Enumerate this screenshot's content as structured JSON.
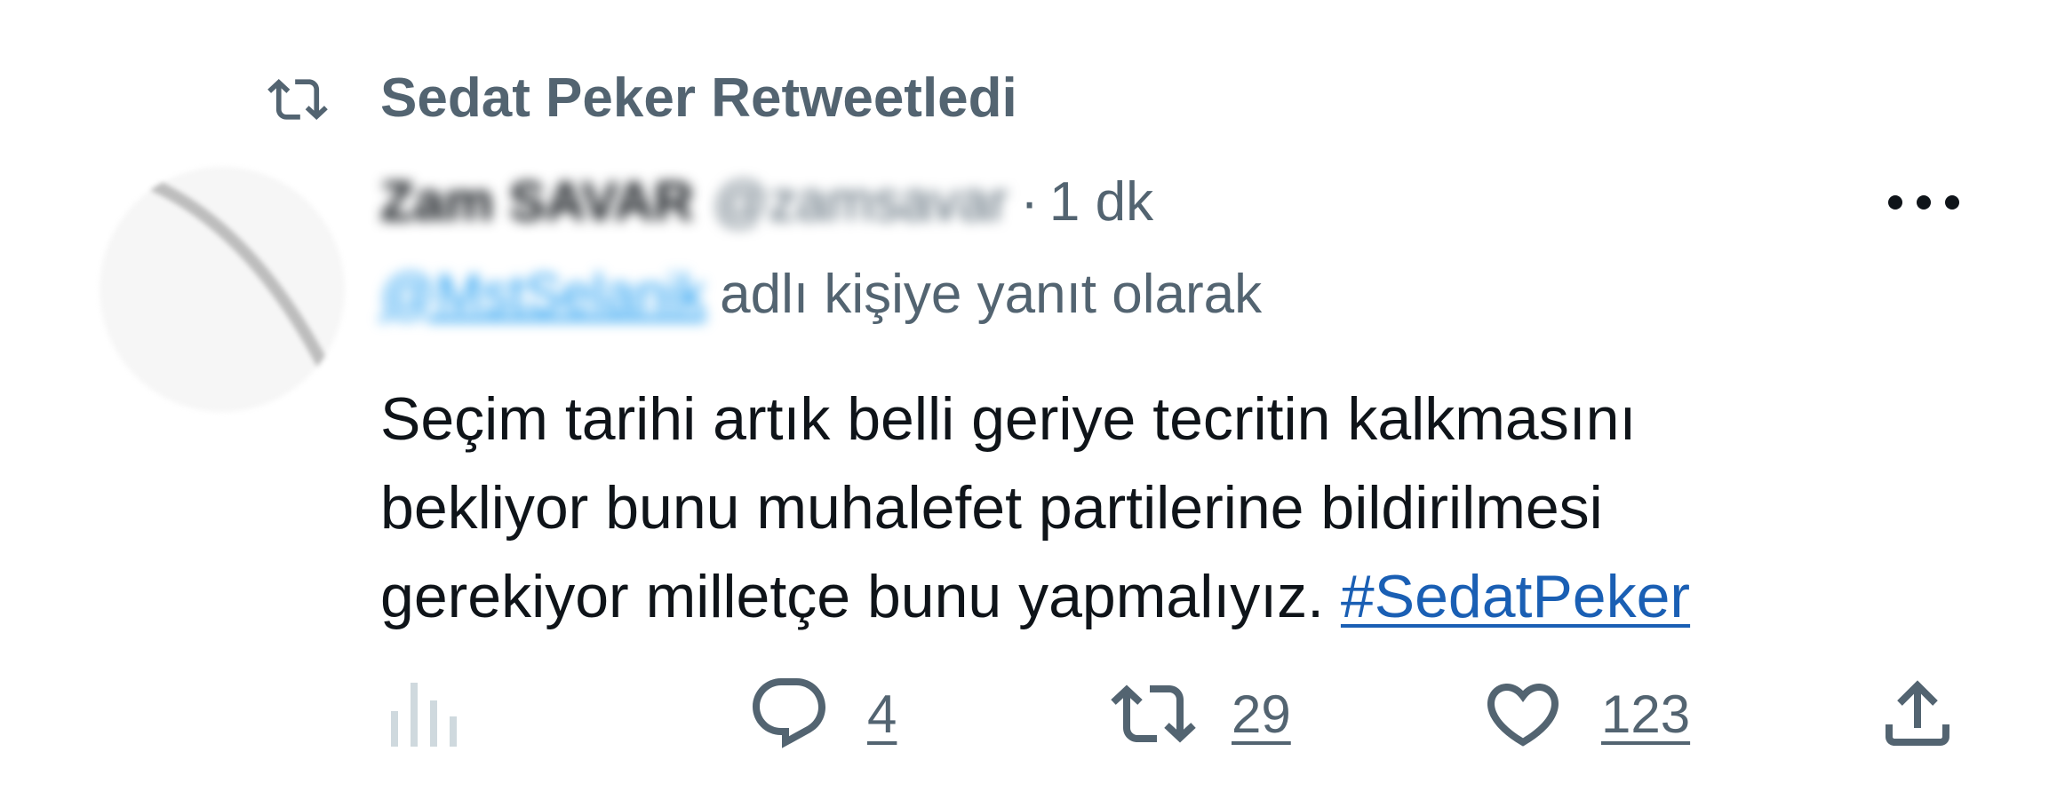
{
  "retweet_header": {
    "icon": "retweet-icon",
    "label": "Sedat Peker Retweetledi"
  },
  "tweet": {
    "author": {
      "display_name": "Zam SAVAR",
      "handle": "@zamsavar"
    },
    "separator": "·",
    "time": "1 dk",
    "reply_to": {
      "handle": "@MstSelanik",
      "text": "adlı kişiye yanıt olarak"
    },
    "body_lines": [
      "Seçim tarihi artık belli geriye tecritin kalkmasını",
      "bekliyor bunu muhalefet partilerine bildirilmesi",
      "gerekiyor milletçe bunu yapmalıyız."
    ],
    "hashtag": "#SedatPeker"
  },
  "actions": {
    "replies": "4",
    "retweets": "29",
    "likes": "123"
  },
  "colors": {
    "secondary_text": "#536471",
    "primary_text": "#0f1419",
    "link": "#1a5fb4",
    "icon_muted": "#cfd9de"
  }
}
